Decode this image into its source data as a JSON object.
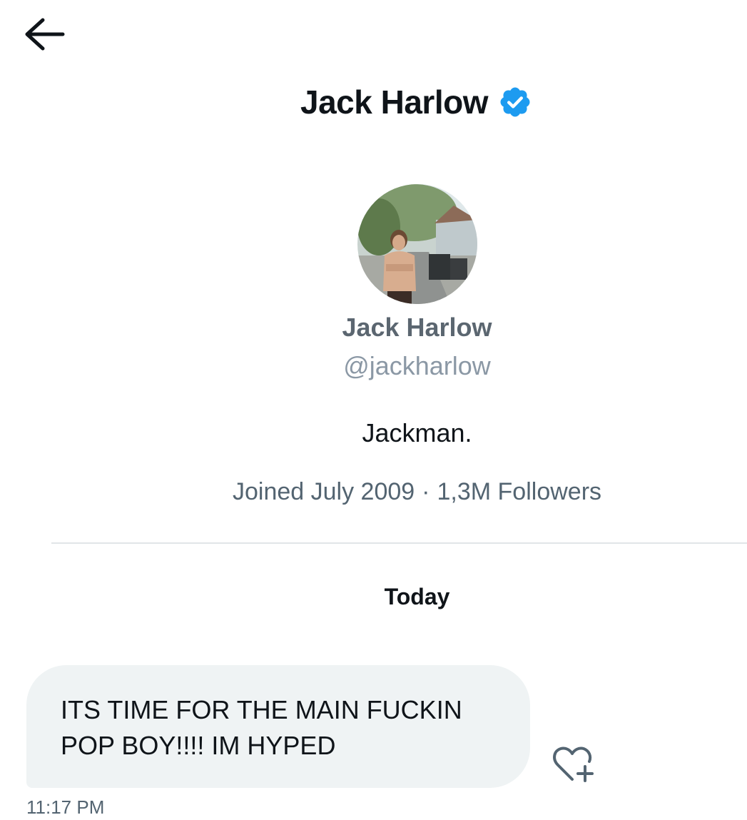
{
  "header": {
    "back_icon": "arrow-left-icon",
    "title": "Jack Harlow",
    "verified_icon": "verified-badge-icon",
    "verified_color": "#1d9bf0"
  },
  "profile": {
    "avatar_icon": "avatar-photo",
    "name": "Jack Harlow",
    "handle": "@jackharlow",
    "bio": "Jackman.",
    "joined": "Joined July 2009",
    "separator": "·",
    "followers": "1,3M Followers"
  },
  "conversation": {
    "day_label": "Today",
    "messages": [
      {
        "text_line1": "ITS TIME FOR THE MAIN FUCKIN",
        "text_line2": "POP BOY!!!! IM HYPED",
        "time": "11:17 PM",
        "reaction_icon": "heart-plus-icon"
      }
    ]
  },
  "colors": {
    "text_primary": "#0f1419",
    "text_secondary": "#536471",
    "bubble_bg": "#eff3f4",
    "divider": "#e1e5e8"
  }
}
